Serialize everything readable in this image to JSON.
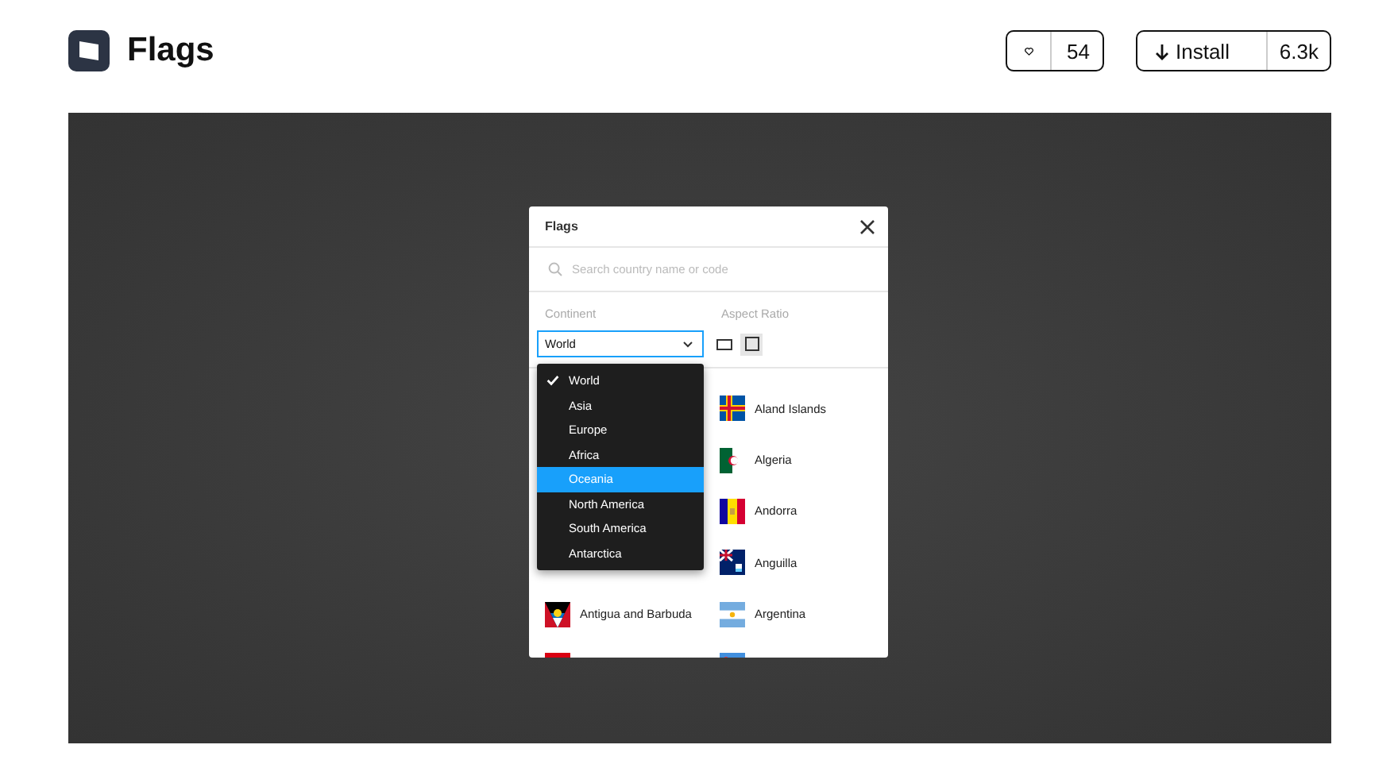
{
  "header": {
    "title": "Flags",
    "like_count": "54",
    "install_label": "Install",
    "install_count": "6.3k"
  },
  "plugin_window": {
    "title": "Flags",
    "search": {
      "placeholder": "Search country name or code"
    },
    "continent": {
      "label": "Continent",
      "value": "World"
    },
    "aspect_ratio": {
      "label": "Aspect Ratio",
      "options": [
        {
          "kind": "wide",
          "selected": false
        },
        {
          "kind": "square",
          "selected": true
        }
      ]
    },
    "dropdown": [
      {
        "label": "World",
        "checked": true,
        "highlighted": false
      },
      {
        "label": "Asia",
        "checked": false,
        "highlighted": false
      },
      {
        "label": "Europe",
        "checked": false,
        "highlighted": false
      },
      {
        "label": "Africa",
        "checked": false,
        "highlighted": false
      },
      {
        "label": "Oceania",
        "checked": false,
        "highlighted": true
      },
      {
        "label": "North America",
        "checked": false,
        "highlighted": false
      },
      {
        "label": "South America",
        "checked": false,
        "highlighted": false
      },
      {
        "label": "Antarctica",
        "checked": false,
        "highlighted": false
      }
    ],
    "countries": [
      {
        "right": {
          "name": "Aland Islands",
          "kind": "aland"
        }
      },
      {
        "right": {
          "name": "Algeria",
          "kind": "algeria"
        }
      },
      {
        "right": {
          "name": "Andorra",
          "kind": "andorra"
        }
      },
      {
        "right": {
          "name": "Anguilla",
          "kind": "anguilla"
        }
      },
      {
        "left": {
          "name": "Antigua and Barbuda",
          "kind": "antigua"
        },
        "right": {
          "name": "Argentina",
          "kind": "argentina"
        }
      },
      {
        "left": {
          "kind": "armenia"
        },
        "right": {
          "kind": "aruba"
        }
      }
    ]
  }
}
